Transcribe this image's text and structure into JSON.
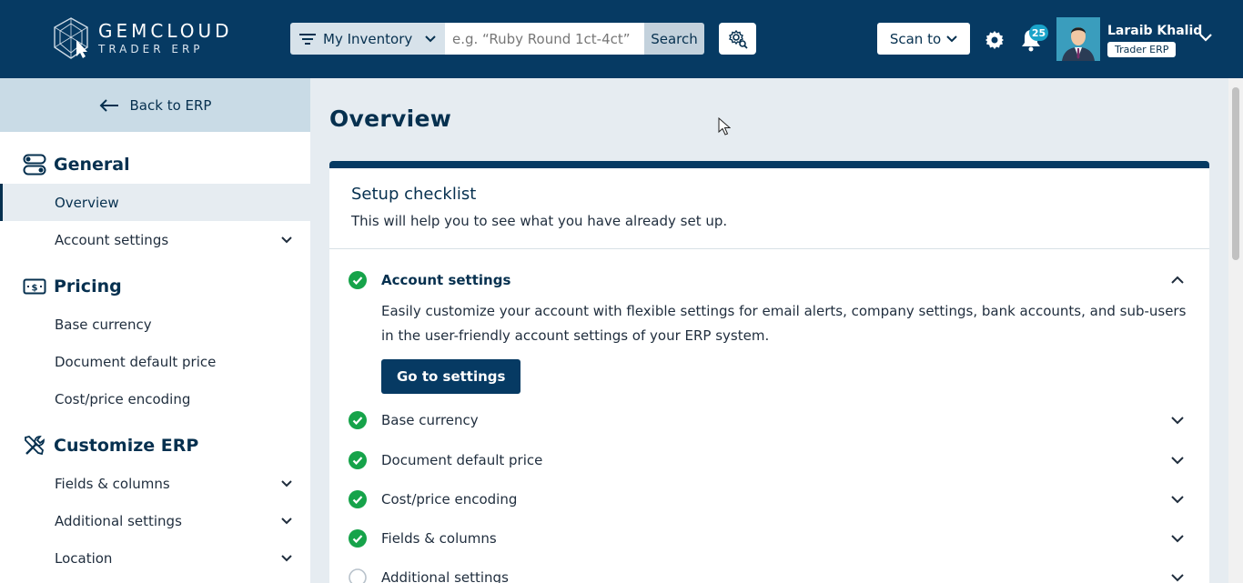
{
  "header": {
    "logo_title": "GEMCLOUD",
    "logo_sub": "TRADER ERP",
    "inventory_select": "My Inventory",
    "search_placeholder": "e.g. “Ruby Round 1ct-4ct”",
    "search_label": "Search",
    "scan_label": "Scan to",
    "notification_count": "25",
    "user_name": "Laraib Khalid",
    "user_role": "Trader ERP"
  },
  "sidebar": {
    "back_label": "Back to ERP",
    "sections": [
      {
        "title": "General",
        "items": [
          "Overview",
          "Account settings"
        ]
      },
      {
        "title": "Pricing",
        "items": [
          "Base currency",
          "Document default price",
          "Cost/price encoding"
        ]
      },
      {
        "title": "Customize ERP",
        "items": [
          "Fields & columns",
          "Additional settings",
          "Location"
        ]
      }
    ]
  },
  "main": {
    "page_title": "Overview",
    "card_title": "Setup checklist",
    "card_subtitle": "This will help you to see what you have already set up.",
    "checklist": [
      {
        "label": "Account settings",
        "done": true,
        "expanded": true
      },
      {
        "label": "Base currency",
        "done": true,
        "expanded": false
      },
      {
        "label": "Document default price",
        "done": true,
        "expanded": false
      },
      {
        "label": "Cost/price encoding",
        "done": true,
        "expanded": false
      },
      {
        "label": "Fields & columns",
        "done": true,
        "expanded": false
      },
      {
        "label": "Additional settings",
        "done": false,
        "expanded": false
      }
    ],
    "expanded_description": "Easily customize your account with flexible settings for email alerts, company settings, bank accounts, and sub-users in the user-friendly account settings of your ERP system.",
    "go_button": "Go to settings"
  },
  "colors": {
    "brand": "#063a63",
    "check_green": "#16a34a",
    "badge": "#1aa3c9"
  }
}
